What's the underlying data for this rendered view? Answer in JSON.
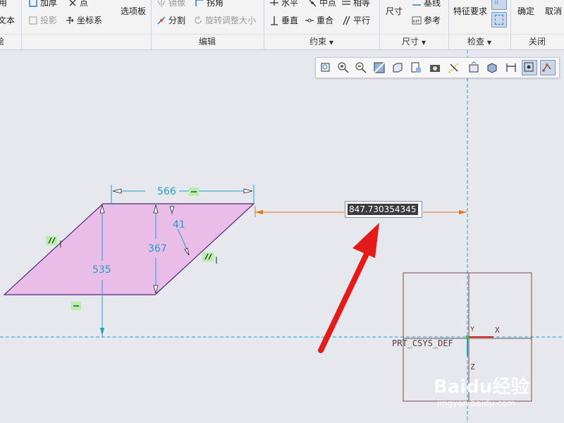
{
  "ribbon": {
    "left_partial": {
      "row1": "用",
      "row2": "文本",
      "group": "绘"
    },
    "sketch": {
      "thicken": "加厚",
      "point": "点",
      "project": "投影",
      "csys": "坐标系",
      "palette": "选项板"
    },
    "editing": {
      "mirror": "镜像",
      "corner": "拐角",
      "divide": "分割",
      "rotate_resize": "旋转调整大小",
      "group": "编辑"
    },
    "constrain": {
      "horizontal": "水平",
      "midpoint": "中点",
      "equal": "相等",
      "vertical": "垂直",
      "coincident": "重合",
      "parallel": "平行",
      "group": "约束"
    },
    "dimension": {
      "dimension": "尺寸",
      "baseline": "基线",
      "reference": "参考",
      "group": "尺寸"
    },
    "inspect": {
      "feature_req": "特征要求",
      "group": "检查"
    },
    "close": {
      "ok": "确定",
      "cancel": "取消",
      "group": "关闭"
    }
  },
  "sketch": {
    "dim_width": "566",
    "dim_height_inner": "367",
    "dim_height_outer": "535",
    "dim_angle": "41",
    "dim_input_value": "847.73035434565",
    "csys_label": "PRT_CSYS_DEF",
    "axis_y": "Y",
    "axis_x": "X",
    "axis_z": "Z"
  },
  "watermark": {
    "brand": "Baidu经验",
    "url": "jingyan.baidu.com"
  },
  "colors": {
    "fill": "#eabde8",
    "dim": "#1ea0c4",
    "orange": "#e0731e",
    "arrow": "#e41b1b",
    "constraint_bg": "#b6f0a6"
  }
}
